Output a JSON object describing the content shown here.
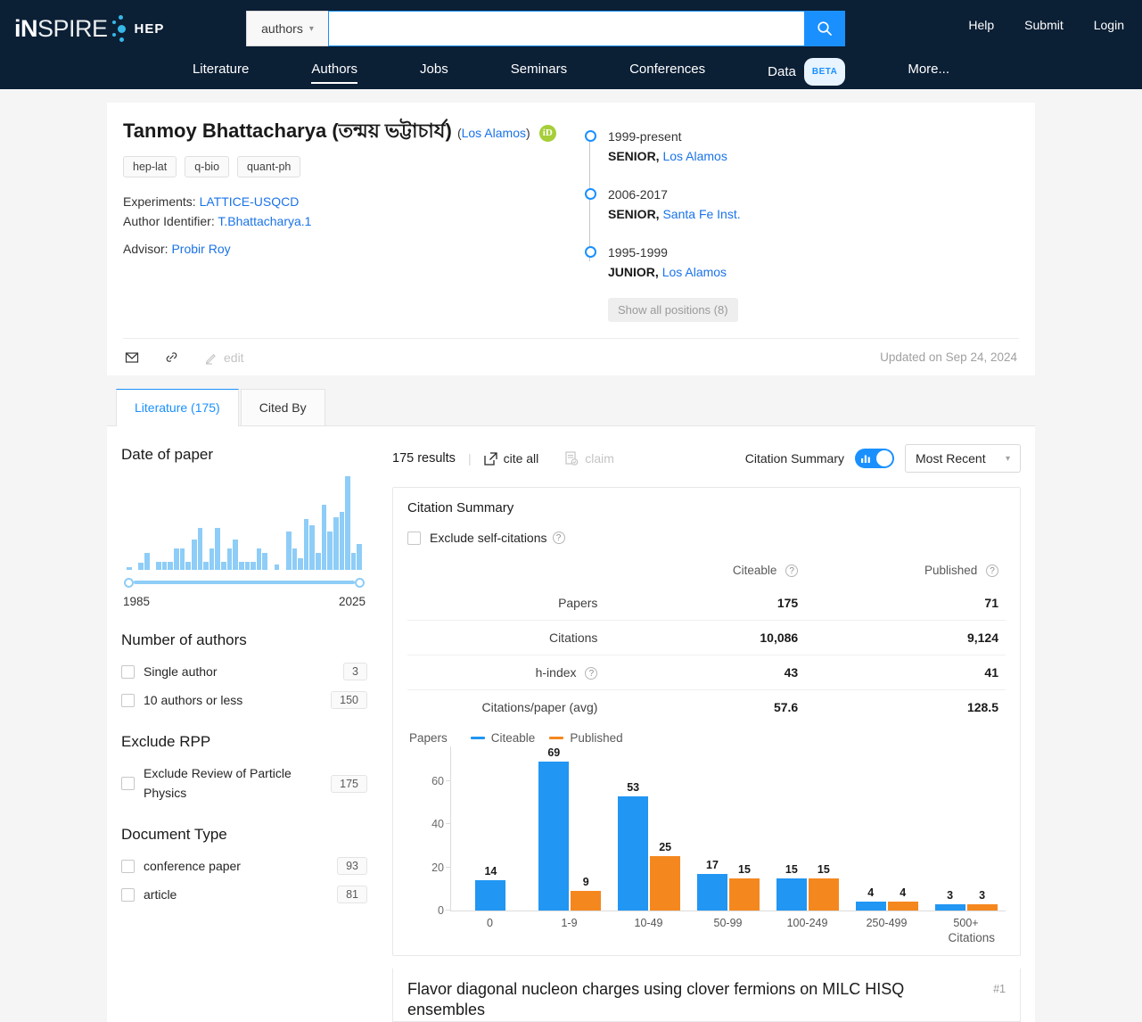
{
  "header": {
    "logo": {
      "part1": "iN",
      "part2": "SPIRE",
      "part3": "HEP"
    },
    "search": {
      "scope": "authors",
      "value": "",
      "placeholder": "",
      "search_icon": "search-icon"
    },
    "links": [
      {
        "label": "Help"
      },
      {
        "label": "Submit"
      },
      {
        "label": "Login"
      }
    ],
    "nav": [
      {
        "label": "Literature",
        "active": false
      },
      {
        "label": "Authors",
        "active": true
      },
      {
        "label": "Jobs",
        "active": false
      },
      {
        "label": "Seminars",
        "active": false
      },
      {
        "label": "Conferences",
        "active": false
      },
      {
        "label": "Data",
        "active": false,
        "badge": "BETA"
      },
      {
        "label": "More...",
        "active": false
      }
    ]
  },
  "author": {
    "name": "Tanmoy Bhattacharya",
    "native_name": "(তন্ময় ভট্টাচার্য)",
    "institution": "Los Alamos",
    "orcid_label": "iD",
    "tags": [
      "hep-lat",
      "q-bio",
      "quant-ph"
    ],
    "experiments_label": "Experiments:",
    "experiments_value": "LATTICE-USQCD",
    "identifier_label": "Author Identifier:",
    "identifier_value": "T.Bhattacharya.1",
    "advisor_label": "Advisor:",
    "advisor_value": "Probir Roy",
    "positions": [
      {
        "years": "1999-present",
        "rank": "SENIOR,",
        "institution": "Los Alamos"
      },
      {
        "years": "2006-2017",
        "rank": "SENIOR,",
        "institution": "Santa Fe Inst."
      },
      {
        "years": "1995-1999",
        "rank": "JUNIOR,",
        "institution": "Los Alamos"
      }
    ],
    "show_all_positions": "Show all positions (8)",
    "actions": [
      {
        "label": "",
        "icon": "envelope-icon",
        "disabled": false
      },
      {
        "label": "",
        "icon": "link-icon",
        "disabled": false
      },
      {
        "label": "edit",
        "icon": "pencil-icon",
        "disabled": true
      }
    ],
    "updated": "Updated on Sep 24, 2024"
  },
  "tabs": [
    {
      "label": "Literature (175)",
      "active": true
    },
    {
      "label": "Cited By",
      "active": false
    }
  ],
  "sidebar": {
    "date_facet": {
      "title": "Date of paper",
      "min_label": "1985",
      "max_label": "2025",
      "bars": [
        3,
        0,
        8,
        18,
        0,
        9,
        9,
        9,
        23,
        23,
        9,
        32,
        45,
        9,
        23,
        45,
        9,
        23,
        32,
        9,
        9,
        9,
        23,
        18,
        0,
        6,
        0,
        41,
        23,
        12,
        54,
        48,
        18,
        70,
        41,
        56,
        62,
        100,
        18,
        28
      ]
    },
    "authors_facet": {
      "title": "Number of authors",
      "items": [
        {
          "label": "Single author",
          "count": "3",
          "checked": false
        },
        {
          "label": "10 authors or less",
          "count": "150",
          "checked": false
        }
      ]
    },
    "rpp_facet": {
      "title": "Exclude RPP",
      "items": [
        {
          "label": "Exclude Review of Particle Physics",
          "count": "175",
          "checked": false
        }
      ]
    },
    "doctype_facet": {
      "title": "Document Type",
      "items": [
        {
          "label": "conference paper",
          "count": "93",
          "checked": false
        },
        {
          "label": "article",
          "count": "81",
          "checked": false
        }
      ]
    }
  },
  "toolbar": {
    "results": "175 results",
    "separator": "|",
    "cite_all": "cite all",
    "claim": "claim",
    "citation_summary_label": "Citation Summary",
    "toggle_on": true,
    "sort_value": "Most Recent"
  },
  "citation_summary": {
    "title": "Citation Summary",
    "exclude_self": "Exclude self-citations",
    "columns": [
      "",
      "Citeable",
      "Published"
    ],
    "rows": [
      {
        "label": "Papers",
        "has_help": false,
        "citeable": "175",
        "published": "71"
      },
      {
        "label": "Citations",
        "has_help": false,
        "citeable": "10,086",
        "published": "9,124"
      },
      {
        "label": "h-index",
        "has_help": true,
        "citeable": "43",
        "published": "41"
      },
      {
        "label": "Citations/paper (avg)",
        "has_help": false,
        "citeable": "57.6",
        "published": "128.5"
      }
    ]
  },
  "chart_data": {
    "type": "bar",
    "title": "",
    "xlabel": "Citations",
    "ylabel": "Papers",
    "categories": [
      "0",
      "1-9",
      "10-49",
      "50-99",
      "100-249",
      "250-499",
      "500+"
    ],
    "series": [
      {
        "name": "Citeable",
        "color": "#2196f3",
        "values": [
          14,
          69,
          53,
          17,
          15,
          4,
          3
        ]
      },
      {
        "name": "Published",
        "color": "#f5871f",
        "values": [
          null,
          9,
          25,
          15,
          15,
          4,
          3
        ]
      }
    ],
    "yticks": [
      0,
      20,
      40,
      60
    ],
    "ylim": [
      0,
      76
    ],
    "grid": false,
    "legend_position": "top-left"
  },
  "first_result": {
    "title": "Flavor diagonal nucleon charges using clover fermions on MILC HISQ ensembles",
    "rank": "#1"
  },
  "colors": {
    "brand_dark": "#0b1f35",
    "accent_blue": "#1a90ff",
    "link_blue": "#1a73e8",
    "citeable": "#2196f3",
    "published": "#f5871f",
    "orcid_green": "#a6ce39",
    "histogram_blue": "#8ecdf7"
  }
}
